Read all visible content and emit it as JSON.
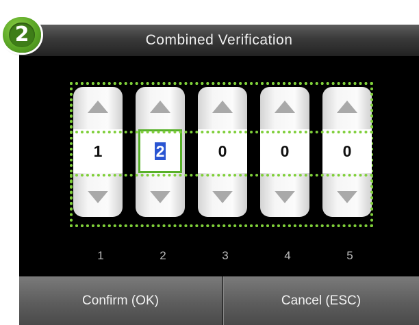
{
  "step_badge": "2",
  "title": "Combined Verification",
  "columns": [
    {
      "index_label": "1",
      "value": "1"
    },
    {
      "index_label": "2",
      "value": "2"
    },
    {
      "index_label": "3",
      "value": "0"
    },
    {
      "index_label": "4",
      "value": "0"
    },
    {
      "index_label": "5",
      "value": "0"
    }
  ],
  "buttons": {
    "confirm": "Confirm (OK)",
    "cancel": "Cancel (ESC)"
  },
  "colors": {
    "highlight_green": "#7fcf3a",
    "selection_blue": "#2a55d2"
  },
  "icons": {
    "increment": "triangle-up-icon",
    "decrement": "triangle-down-icon"
  }
}
